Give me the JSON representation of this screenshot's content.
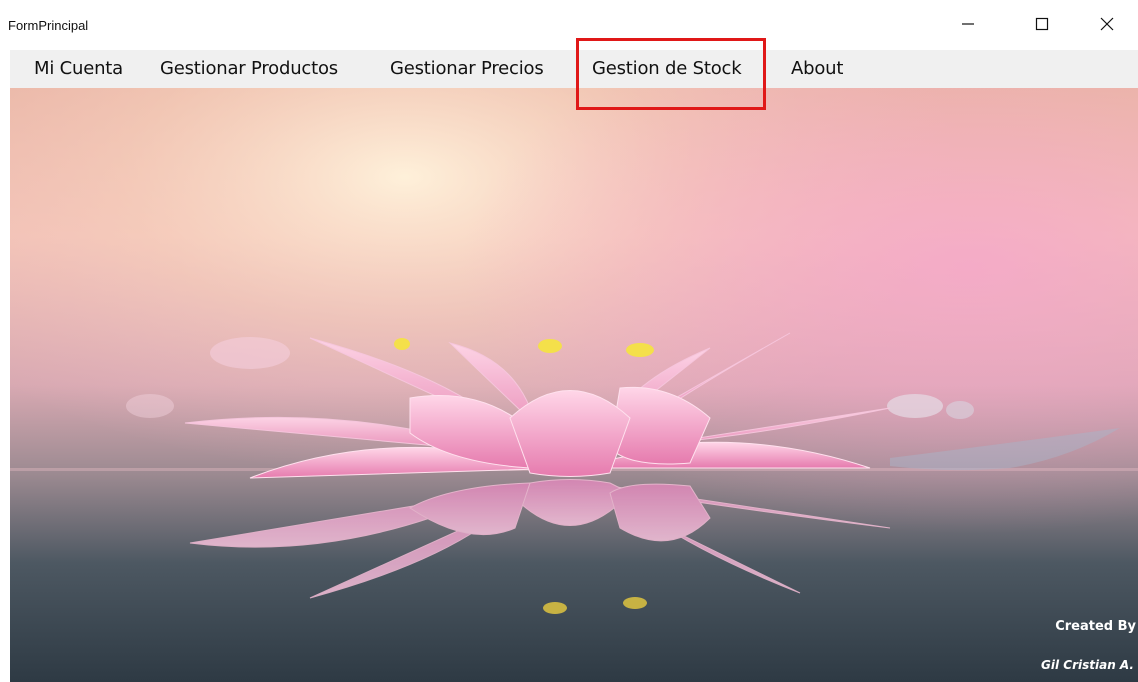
{
  "window": {
    "title": "FormPrincipal"
  },
  "menu": {
    "items": [
      {
        "label": "Mi Cuenta"
      },
      {
        "label": "Gestionar Productos"
      },
      {
        "label": "Gestionar Precios"
      },
      {
        "label": "Gestion de Stock",
        "highlighted": true
      },
      {
        "label": "About"
      }
    ]
  },
  "footer": {
    "created_by": "Created By",
    "author": "Gil Cristian A."
  },
  "colors": {
    "highlight": "#e01818",
    "menu_bg": "#f0f0f0",
    "flower_pink": "#f2a2c8"
  },
  "icons": {
    "minimize": "minimize-icon",
    "maximize": "maximize-icon",
    "close": "close-icon"
  }
}
